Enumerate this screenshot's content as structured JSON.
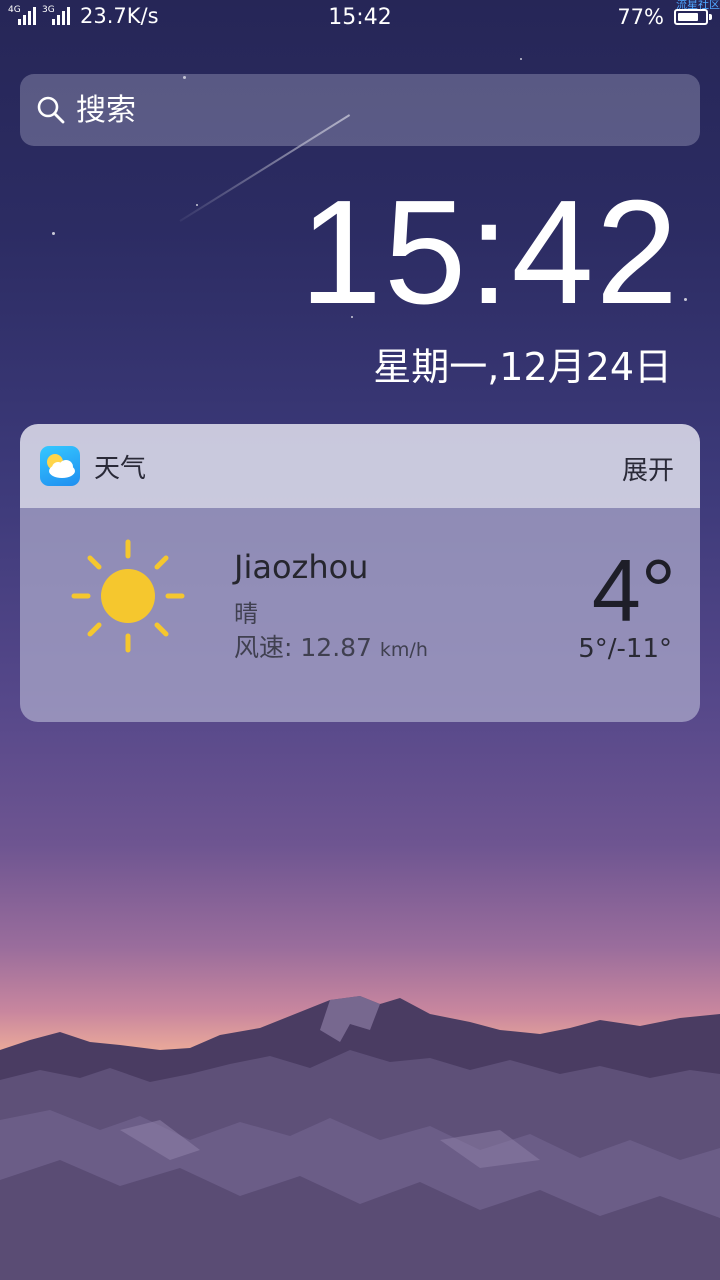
{
  "status_bar": {
    "network_1": "4G",
    "network_2": "4G",
    "network_3": "3G",
    "speed": "23.7K/s",
    "time": "15:42",
    "battery": "77%",
    "battery_level": 0.77,
    "watermark": "流星社区"
  },
  "search": {
    "placeholder": "搜索"
  },
  "clock": {
    "time": "15:42",
    "date": "星期一,12月24日"
  },
  "weather": {
    "app_name": "天气",
    "expand_label": "展开",
    "city": "Jiaozhou",
    "condition": "晴",
    "wind_label": "风速:",
    "wind_value": "12.87",
    "wind_unit": "km/h",
    "temperature": "4°",
    "range": "5°/-11°"
  },
  "colors": {
    "sun": "#f5c72e",
    "app_icon": "#1f8ef0"
  }
}
